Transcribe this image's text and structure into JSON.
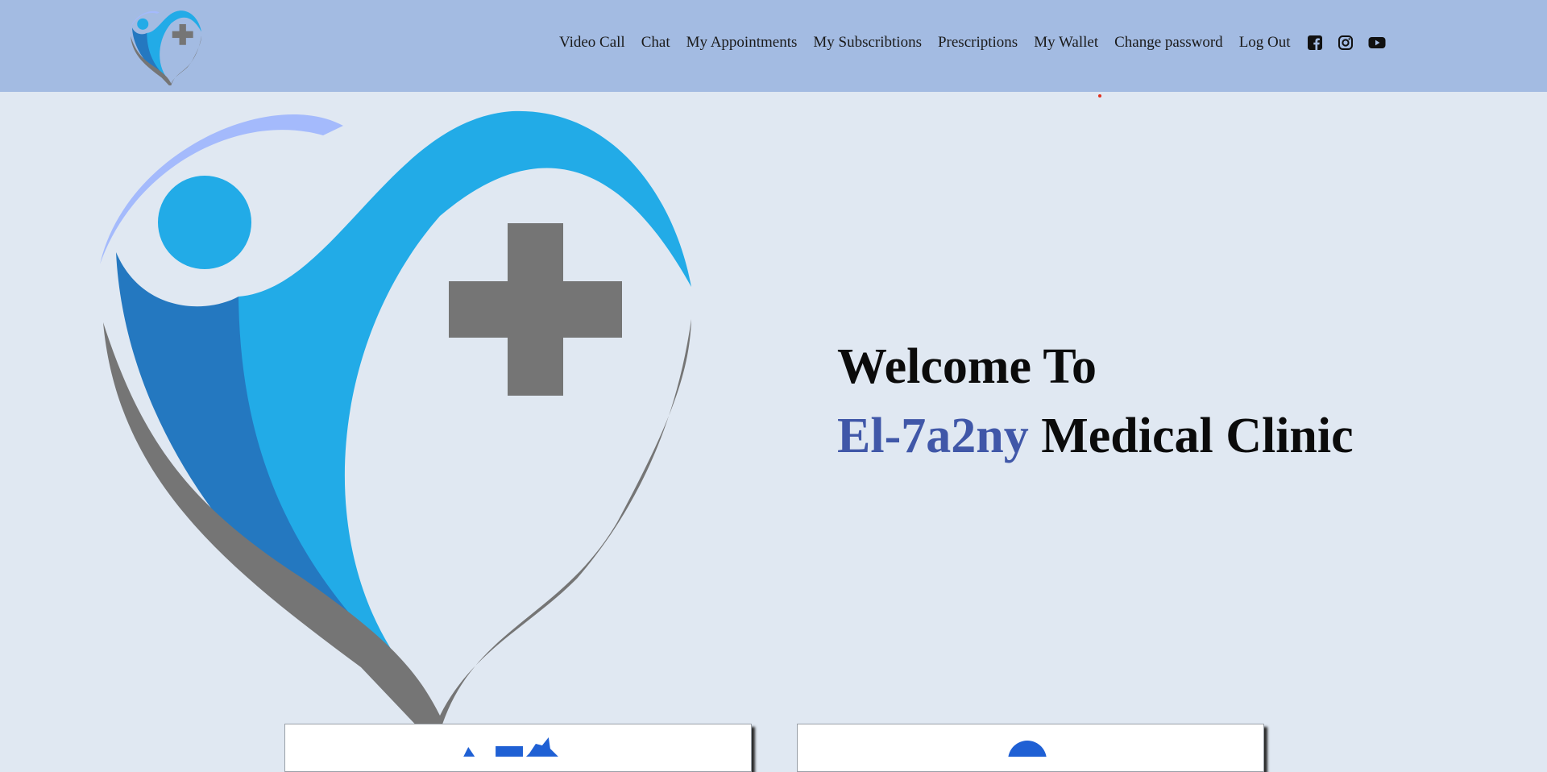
{
  "navbar": {
    "logo": "clinic-logo",
    "links": [
      {
        "label": "Video Call"
      },
      {
        "label": "Chat"
      },
      {
        "label": "My Appointments"
      },
      {
        "label": "My Subscribtions"
      },
      {
        "label": "Prescriptions"
      },
      {
        "label": "My Wallet"
      },
      {
        "label": "Change password"
      },
      {
        "label": "Log Out"
      }
    ],
    "social": [
      "facebook-icon",
      "instagram-icon",
      "youtube-icon"
    ]
  },
  "hero": {
    "welcome_line": "Welcome To",
    "brand_name": "El-7a2ny",
    "clinic_suffix": " Medical Clinic"
  },
  "colors": {
    "navbar_bg": "#a3bbe2",
    "page_bg": "#e0e8f2",
    "brand_blue": "#4057a8",
    "logo_light_blue": "#22abe7",
    "logo_dark_blue": "#2478c0",
    "logo_gray": "#757575",
    "logo_arc": "#a4bafc"
  },
  "cards": [
    {
      "icon": "team-icon"
    },
    {
      "icon": "user-icon"
    }
  ]
}
